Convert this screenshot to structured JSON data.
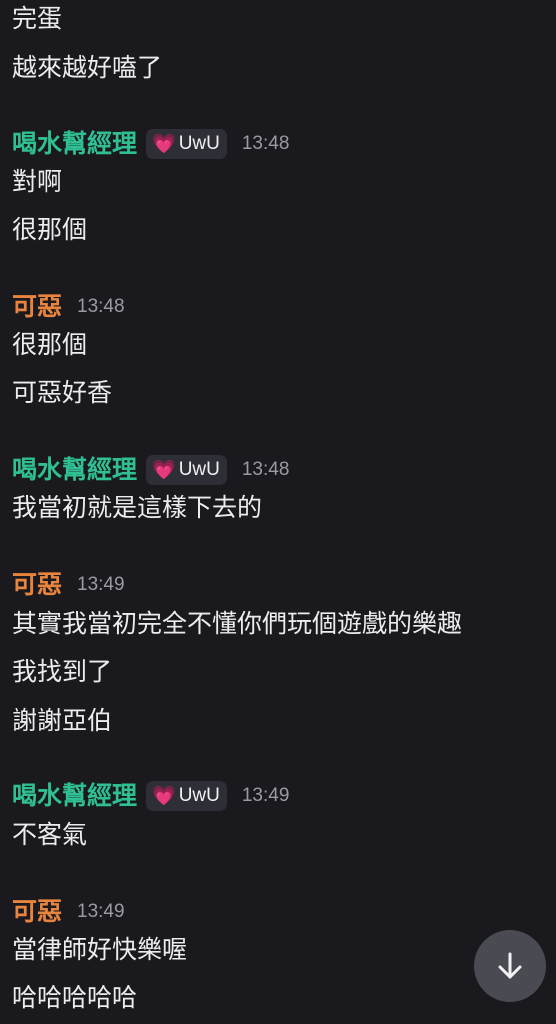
{
  "messages_top": [
    "完蛋",
    "越來越好嗑了"
  ],
  "groups": [
    {
      "author": "喝水幫經理",
      "tag": "UwU",
      "time": "13:48",
      "lines": [
        "對啊",
        "很那個"
      ]
    },
    {
      "author": "可惡",
      "time": "13:48",
      "lines": [
        "很那個",
        "可惡好香"
      ]
    },
    {
      "author": "喝水幫經理",
      "tag": "UwU",
      "time": "13:48",
      "lines": [
        "我當初就是這樣下去的"
      ]
    },
    {
      "author": "可惡",
      "time": "13:49",
      "lines": [
        "其實我當初完全不懂你們玩個遊戲的樂趣",
        "我找到了",
        "謝謝亞伯"
      ]
    },
    {
      "author": "喝水幫經理",
      "tag": "UwU",
      "time": "13:49",
      "lines": [
        "不客氣"
      ]
    },
    {
      "author": "可惡",
      "time": "13:49",
      "lines": [
        "當律師好快樂喔",
        "哈哈哈哈哈"
      ]
    }
  ],
  "colors": {
    "background": "#1a1a1e",
    "author_green": "#2fbf93",
    "author_orange": "#e8843d",
    "timestamp": "#9a9aa2",
    "tag_background": "#2e2f36"
  },
  "icons": {
    "tag_icon": "pink-heart-icon",
    "scroll_button_icon": "arrow-down-icon"
  }
}
